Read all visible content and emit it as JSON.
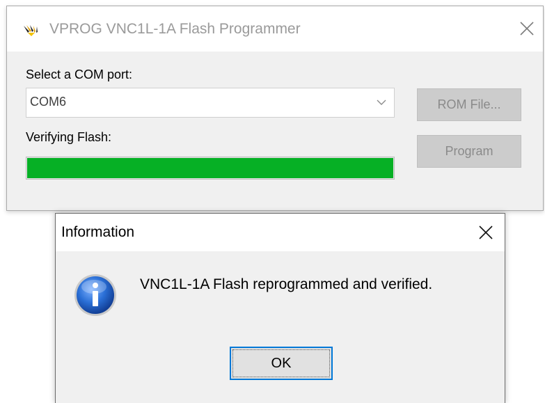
{
  "main_window": {
    "title": "VPROG VNC1L-1A Flash Programmer",
    "com_label": "Select a COM port:",
    "com_value": "COM6",
    "status_label": "Verifying Flash:",
    "progress_percent": 100,
    "rom_file_button": "ROM File...",
    "program_button": "Program"
  },
  "info_dialog": {
    "title": "Information",
    "message": "VNC1L-1A Flash reprogrammed and verified.",
    "ok_button": "OK"
  },
  "colors": {
    "progress_fill": "#06b025",
    "ok_focus_border": "#0078d7",
    "info_icon_blue": "#1b5fbf"
  }
}
